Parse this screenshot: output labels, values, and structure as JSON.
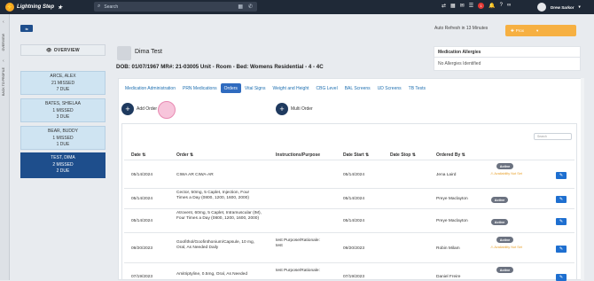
{
  "app": {
    "title": "Lightning Step",
    "search_placeholder": "Search",
    "user_name": "Drew Sarkor",
    "notif_count": "1"
  },
  "rail": {
    "t1": "OVERVIEW",
    "t2": "BACK TO PROFILE"
  },
  "sidebar": {
    "collapse_label": "⇆",
    "overview_label": "OVERVIEW",
    "patients": [
      {
        "name": "ARCE, ALEX",
        "missed": "21 MISSED",
        "due": "7 DUE"
      },
      {
        "name": "BATES, SHIELAA",
        "missed": "1 MISSED",
        "due": "3 DUE"
      },
      {
        "name": "BEAR, BUDDY",
        "missed": "1 MISSED",
        "due": "1 DUE"
      },
      {
        "name": "TEST, DIMA",
        "missed": "2 MISSED",
        "due": "2 DUE"
      }
    ]
  },
  "header": {
    "patient_name": "Dima Test",
    "info": "DOB: 01/07/1967   MR#: 21-03005   Unit - Room - Bed: Womens Residential - 4 - 4C",
    "auto_refresh": "Auto Refresh in 13 Minutes",
    "action_label": "Prox",
    "allergy_title": "Medication Allergies",
    "allergy_value": "No Allergies Identified"
  },
  "tabs": [
    "Medication Administration",
    "PRN Medications",
    "Orders",
    "Vital Signs",
    "Weight and Height",
    "CBG Level",
    "BAL Screens",
    "UD Screens",
    "TB Tests"
  ],
  "active_tab": "Orders",
  "actions": {
    "add_order": "Add Order",
    "multi_order": "Multi Order",
    "search_placeholder": "Search"
  },
  "table": {
    "columns": [
      "Date",
      "Order",
      "Instructions/Purpose",
      "Date Start",
      "Date Stop",
      "Ordered By"
    ],
    "status_label": "Active",
    "availability_text": "Availability Not Set",
    "rows": [
      {
        "date": "05/14/2024",
        "order": "CIWA AR CIWA-AR",
        "instructions": "",
        "start": "05/14/2024",
        "stop": "",
        "by": "Jena Laird",
        "avail": true
      },
      {
        "date": "05/14/2024",
        "order": "Cector, 50mg, 5 Caplet, Injection, Four Times a Day (0800, 1200, 1600, 2000)",
        "instructions": "",
        "start": "05/14/2024",
        "stop": "",
        "by": "Preye Maclayton",
        "avail": false
      },
      {
        "date": "05/14/2024",
        "order": "Atrovent, 60mg, 5 Caplet, Intramuscular (IM), Four Times a Day (0800, 1200, 1600, 2000)",
        "instructions": "",
        "start": "05/14/2024",
        "stop": "",
        "by": "Preye Maclayton",
        "avail": false
      },
      {
        "date": "09/20/2023",
        "order": "Goofithol/Goofinthonium/Capsule, 10 mg, Oral, As Needed Daily",
        "instructions": "test Purpose/Rationale: test",
        "start": "09/20/2023",
        "stop": "",
        "by": "Robin Milam",
        "avail": true
      },
      {
        "date": "07/19/2023",
        "order": "Amitriptyline, 0.5mg, Oral, As Needed",
        "instructions": "test Purpose/Rationale:",
        "start": "07/19/2023",
        "stop": "",
        "by": "Daniel Freire",
        "avail": true
      }
    ]
  }
}
